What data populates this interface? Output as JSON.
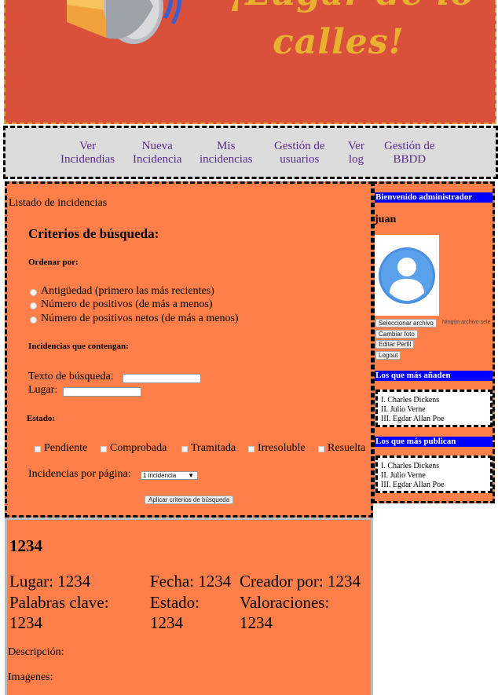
{
  "banner": {
    "slogan_line1": "¡Lugar de lo",
    "slogan_line2": "calles!",
    "slogan_color": "#e8b12f",
    "background_color": "#d9503b",
    "icon": "megaphone-icon"
  },
  "nav": {
    "items": [
      {
        "line1": "Ver",
        "line2": "Incidendias"
      },
      {
        "line1": "Nueva",
        "line2": "Incidencia"
      },
      {
        "line1": "Mis",
        "line2": "incidencias"
      },
      {
        "line1": "Gestión de",
        "line2": "usuarios"
      },
      {
        "line1": "Ver",
        "line2": "log"
      },
      {
        "line1": "Gestión de",
        "line2": "BBDD"
      }
    ]
  },
  "listing": {
    "title": "Listado de incidencias",
    "criteria_heading": "Criterios de búsqueda:",
    "order_label": "Ordenar por:",
    "order_options": [
      "Antigüedad (primero las más recientes)",
      "Número de positivos (de más a menos)",
      "Número de positivos netos (de más a menos)"
    ],
    "contains_label": "Incidencias que contengan:",
    "search_text_label": "Texto de búsqueda:",
    "search_text_value": "",
    "place_label": "Lugar:",
    "place_value": "",
    "status_label": "Estado:",
    "status_options": [
      "Pendiente",
      "Comprobada",
      "Tramitada",
      "Irresoluble",
      "Resuelta"
    ],
    "per_page_label": "Incidencias por página:",
    "per_page_value": "1 incidencia",
    "apply_button": "Aplicar criterios de búsqueda"
  },
  "incident": {
    "id": "1234",
    "place_label": "Lugar: 1234",
    "date_label": "Fecha: 1234",
    "creator_label": "Creador por: 1234",
    "keywords_label": "Palabras clave:",
    "keywords_value": "1234",
    "status_label": "Estado:",
    "status_value": "1234",
    "ratings_label": "Valoraciones:",
    "ratings_value": "1234",
    "description_label": "Descripción:",
    "images_label": "Imagenes:"
  },
  "sidebar": {
    "welcome": "Bienvenido administrador",
    "username": "juan",
    "avatar_icon": "user-avatar-icon",
    "choose_file_button": "Seleccionar archivo",
    "no_file_text": "Ningún archivo sele",
    "change_photo_button": "Cambiar foto",
    "edit_profile_button": "Editar Perfil",
    "logout_button": "Logout",
    "top_adders_title": "Los que más añaden",
    "top_adders": [
      "I. Charles Dickens",
      "II. Julio Verne",
      "III. Egdar Allan Poe"
    ],
    "top_publishers_title": "Los que más publican",
    "top_publishers": [
      "I. Charles Dickens",
      "II. Julio Verne",
      "III. Egdar Allan Poe"
    ],
    "accent_color": "#0000ff"
  }
}
